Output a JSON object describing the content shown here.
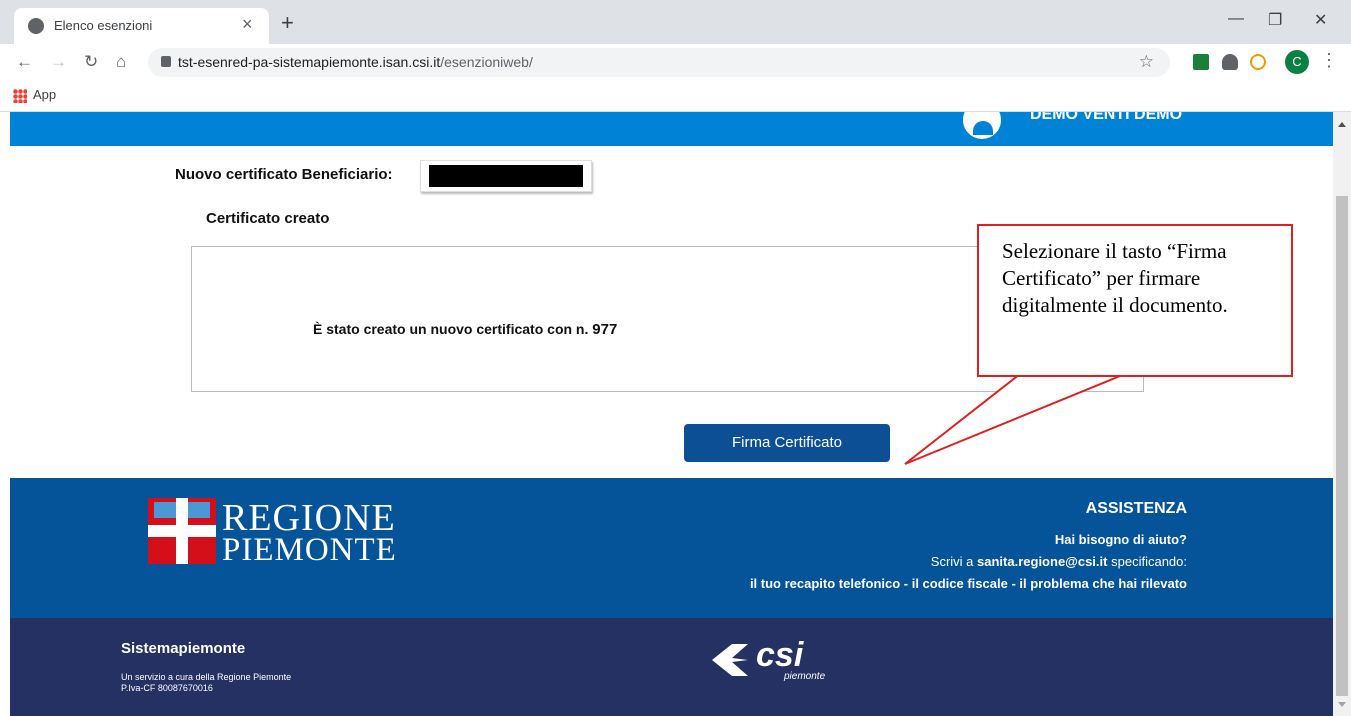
{
  "browser": {
    "tab_title": "Elenco esenzioni",
    "tab_close": "×",
    "new_tab": "+",
    "url_host": "tst-esenred-pa-sistemapiemonte.isan.csi.it",
    "url_path": "/esenzioniweb/",
    "profile_initial": "C",
    "bookmarks_app_label": "App",
    "win_minimize": "—",
    "win_restore": "❐",
    "win_close": "✕"
  },
  "header": {
    "user_name": "DEMO VENTI DEMO"
  },
  "content": {
    "beneficiary_label": "Nuovo certificato Beneficiario:",
    "section_title": "Certificato creato",
    "message_text": "È stato creato un nuovo certificato con n.",
    "certificate_number": "977",
    "sign_button": "Firma Certificato"
  },
  "callout": {
    "text": "Selezionare il tasto “Firma Certificato” per firmare digitalmente il documento."
  },
  "footer": {
    "logo_line1": "REGIONE",
    "logo_line2": "PIEMONTE",
    "assistance_title": "ASSISTENZA",
    "assistance_help": "Hai bisogno di aiuto?",
    "assistance_write_prefix": "Scrivi a",
    "assistance_email": "sanita.regione@csi.it",
    "assistance_write_suffix": "specificando:",
    "assistance_list": "il tuo recapito telefonico - il codice fiscale - il problema che hai rilevato",
    "service_title": "Sistemapiemonte",
    "service_sub1": "Un servizio a cura della Regione Piemonte",
    "service_sub2": "P.Iva-CF 80087670016",
    "csi_logo": "csi",
    "csi_logo_sub": "piemonte"
  },
  "colors": {
    "header_blue": "#0083d6",
    "footer_blue": "#055398",
    "footer_navy": "#253162",
    "button_blue": "#0d4f95",
    "callout_red": "#e02020"
  }
}
